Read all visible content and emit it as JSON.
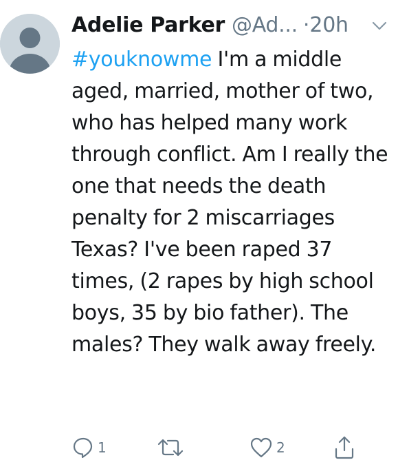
{
  "tweet": {
    "author_name": "Adelie Parker",
    "handle": "@Ad...",
    "separator": "·",
    "time": "20h",
    "hashtag": "#youknowme",
    "text": " I'm a middle aged, married, mother of two, who has helped many work through conflict. Am I really the one that needs the death penalty for 2 miscarriages Texas? I've been raped 37 times, (2 rapes by high school boys, 35 by bio father). The males? They walk away freely."
  },
  "actions": {
    "reply_count": "1",
    "retweet_count": "",
    "like_count": "2"
  },
  "icons": {
    "avatar": "default-avatar-icon",
    "caret": "chevron-down-icon",
    "reply": "reply-icon",
    "retweet": "retweet-icon",
    "like": "heart-icon",
    "share": "share-icon"
  },
  "colors": {
    "hashtag": "#1da1f2",
    "secondary_text": "#657786",
    "primary_text": "#14171a",
    "avatar_bg": "#ccd6dd",
    "avatar_fg": "#657786"
  }
}
